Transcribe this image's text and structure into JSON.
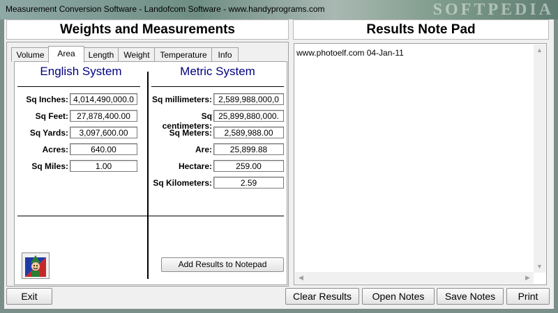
{
  "window": {
    "title": "Measurement Conversion Software - Landofcom Software - www.handyprograms.com",
    "watermark": "SOFTPEDIA"
  },
  "left_header": "Weights and Measurements",
  "right_header": "Results Note Pad",
  "tabs": [
    {
      "label": "Volume",
      "active": false
    },
    {
      "label": "Area",
      "active": true
    },
    {
      "label": "Length",
      "active": false
    },
    {
      "label": "Weight",
      "active": false
    },
    {
      "label": "Temperature",
      "active": false
    },
    {
      "label": "Info",
      "active": false
    }
  ],
  "english": {
    "heading": "English System",
    "rows": [
      {
        "label": "Sq Inches:",
        "value": "4,014,490,000.0"
      },
      {
        "label": "Sq Feet:",
        "value": "27,878,400.00"
      },
      {
        "label": "Sq Yards:",
        "value": "3,097,600.00"
      },
      {
        "label": "Acres:",
        "value": "640.00"
      },
      {
        "label": "Sq Miles:",
        "value": "1.00"
      }
    ]
  },
  "metric": {
    "heading": "Metric System",
    "rows": [
      {
        "label": "Sq millimeters:",
        "value": "2,589,988,000,0"
      },
      {
        "label": "Sq centimeters:",
        "value": "25,899,880,000."
      },
      {
        "label": "Sq Meters:",
        "value": "2,589,988.00"
      },
      {
        "label": "Are:",
        "value": "25,899.88"
      },
      {
        "label": "Hectare:",
        "value": "259.00"
      },
      {
        "label": "Sq Kilometers:",
        "value": "2.59"
      }
    ]
  },
  "add_results_label": "Add Results to Notepad",
  "notepad": {
    "text": "www.photoelf.com  04-Jan-11"
  },
  "buttons": {
    "exit": "Exit",
    "clear": "Clear Results",
    "open": "Open Notes",
    "save": "Save Notes",
    "print": "Print"
  },
  "colors": {
    "system_heading": "#000080",
    "panel_bg": "#f0f0f0"
  },
  "icons": {
    "mascot": "elf-mascot-icon",
    "scroll_up": "scroll-up-arrow",
    "scroll_down": "scroll-down-arrow",
    "scroll_left": "scroll-left-arrow",
    "scroll_right": "scroll-right-arrow"
  }
}
